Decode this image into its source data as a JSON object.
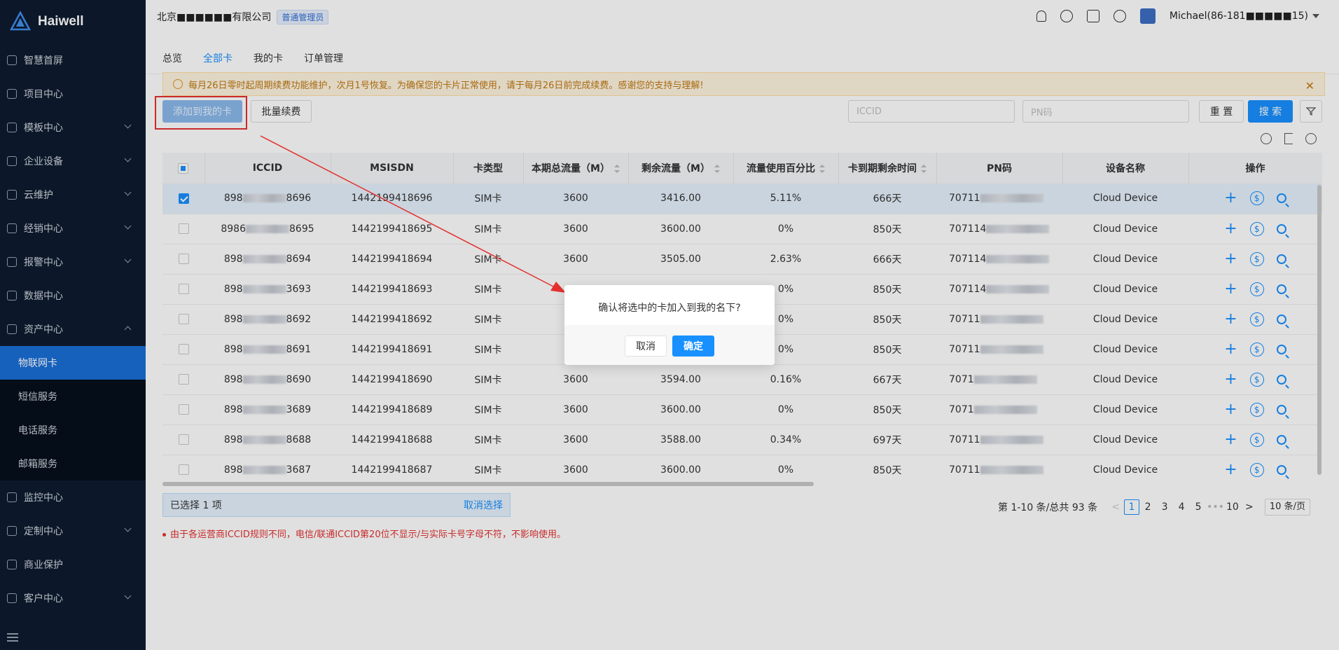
{
  "app": {
    "brand": "Haiwell",
    "brand_sub": "Haiwell"
  },
  "sidebar": {
    "items": [
      {
        "label": "智慧首屏",
        "icon": "globe-icon"
      },
      {
        "label": "项目中心",
        "icon": "project-icon"
      },
      {
        "label": "模板中心",
        "icon": "template-icon"
      },
      {
        "label": "企业设备",
        "icon": "device-icon"
      },
      {
        "label": "云维护",
        "icon": "cloud-icon"
      },
      {
        "label": "经销中心",
        "icon": "dealer-icon"
      },
      {
        "label": "报警中心",
        "icon": "alarm-icon"
      },
      {
        "label": "数据中心",
        "icon": "data-icon"
      },
      {
        "label": "资产中心",
        "icon": "asset-icon"
      }
    ],
    "sub_items": [
      {
        "label": "物联网卡"
      },
      {
        "label": "短信服务"
      },
      {
        "label": "电话服务"
      },
      {
        "label": "邮箱服务"
      }
    ],
    "items_after": [
      {
        "label": "监控中心",
        "icon": "monitor-icon"
      },
      {
        "label": "定制中心",
        "icon": "custom-icon"
      },
      {
        "label": "商业保护",
        "icon": "shield-icon"
      },
      {
        "label": "客户中心",
        "icon": "customer-icon"
      }
    ]
  },
  "header": {
    "company": "北京■■■■■■有限公司",
    "role": "普通管理员",
    "user": "Michael(86-181■■■■■15)"
  },
  "tabs": [
    "总览",
    "全部卡",
    "我的卡",
    "订单管理"
  ],
  "notice": {
    "text": "每月26日零时起周期续费功能维护，次月1号恢复。为确保您的卡片正常使用，请于每月26日前完成续费。感谢您的支持与理解!",
    "close": "✕"
  },
  "toolbar": {
    "add_to_mine": "添加到我的卡",
    "batch_renew": "批量续费",
    "iccid_placeholder": "ICCID",
    "pn_placeholder": "PN码",
    "reset": "重 置",
    "search": "搜 索"
  },
  "table": {
    "columns": [
      "ICCID",
      "MSISDN",
      "卡类型",
      "本期总流量（M）",
      "剩余流量（M）",
      "流量使用百分比",
      "卡到期剩余时间",
      "PN码",
      "设备名称",
      "操作"
    ],
    "rows": [
      {
        "checked": true,
        "iccid_pre": "898",
        "iccid_suf": "8696",
        "msisdn": "1442199418696",
        "type": "SIM卡",
        "total": "3600",
        "remain": "3416.00",
        "pct": "5.11%",
        "days": "666天",
        "pn_pre": "70711",
        "device": "Cloud Device"
      },
      {
        "checked": false,
        "iccid_pre": "8986",
        "iccid_suf": "8695",
        "msisdn": "1442199418695",
        "type": "SIM卡",
        "total": "3600",
        "remain": "3600.00",
        "pct": "0%",
        "days": "850天",
        "pn_pre": "707114",
        "device": "Cloud Device"
      },
      {
        "checked": false,
        "iccid_pre": "898",
        "iccid_suf": "8694",
        "msisdn": "1442199418694",
        "type": "SIM卡",
        "total": "3600",
        "remain": "3505.00",
        "pct": "2.63%",
        "days": "666天",
        "pn_pre": "707114",
        "device": "Cloud Device"
      },
      {
        "checked": false,
        "iccid_pre": "898",
        "iccid_suf": "3693",
        "msisdn": "1442199418693",
        "type": "SIM卡",
        "total": "",
        "remain": "",
        "pct": "0%",
        "days": "850天",
        "pn_pre": "707114",
        "device": "Cloud Device"
      },
      {
        "checked": false,
        "iccid_pre": "898",
        "iccid_suf": "8692",
        "msisdn": "1442199418692",
        "type": "SIM卡",
        "total": "",
        "remain": "",
        "pct": "0%",
        "days": "850天",
        "pn_pre": "70711",
        "device": "Cloud Device"
      },
      {
        "checked": false,
        "iccid_pre": "898",
        "iccid_suf": "8691",
        "msisdn": "1442199418691",
        "type": "SIM卡",
        "total": "",
        "remain": "",
        "pct": "0%",
        "days": "850天",
        "pn_pre": "70711",
        "device": "Cloud Device"
      },
      {
        "checked": false,
        "iccid_pre": "898",
        "iccid_suf": "8690",
        "msisdn": "1442199418690",
        "type": "SIM卡",
        "total": "3600",
        "remain": "3594.00",
        "pct": "0.16%",
        "days": "667天",
        "pn_pre": "7071",
        "device": "Cloud Device"
      },
      {
        "checked": false,
        "iccid_pre": "898",
        "iccid_suf": "3689",
        "msisdn": "1442199418689",
        "type": "SIM卡",
        "total": "3600",
        "remain": "3600.00",
        "pct": "0%",
        "days": "850天",
        "pn_pre": "7071",
        "device": "Cloud Device"
      },
      {
        "checked": false,
        "iccid_pre": "898",
        "iccid_suf": "8688",
        "msisdn": "1442199418688",
        "type": "SIM卡",
        "total": "3600",
        "remain": "3588.00",
        "pct": "0.34%",
        "days": "697天",
        "pn_pre": "70711",
        "device": "Cloud Device"
      },
      {
        "checked": false,
        "iccid_pre": "898",
        "iccid_suf": "3687",
        "msisdn": "1442199418687",
        "type": "SIM卡",
        "total": "3600",
        "remain": "3600.00",
        "pct": "0%",
        "days": "850天",
        "pn_pre": "70711",
        "device": "Cloud Device"
      }
    ],
    "op_dollar": "$"
  },
  "selection": {
    "text": "已选择  1  项",
    "cancel": "取消选择"
  },
  "pager": {
    "summary": "第 1-10 条/总共 93 条",
    "pages": [
      "1",
      "2",
      "3",
      "4",
      "5",
      "•••",
      "10"
    ],
    "prev": "<",
    "next": ">",
    "size": "10 条/页"
  },
  "footnote": "由于各运营商ICCID规则不同，电信/联通ICCID第20位不显示/与实际卡号字母不符，不影响使用。",
  "dialog": {
    "message": "确认将选中的卡加入到我的名下?",
    "cancel": "取消",
    "ok": "确定"
  }
}
